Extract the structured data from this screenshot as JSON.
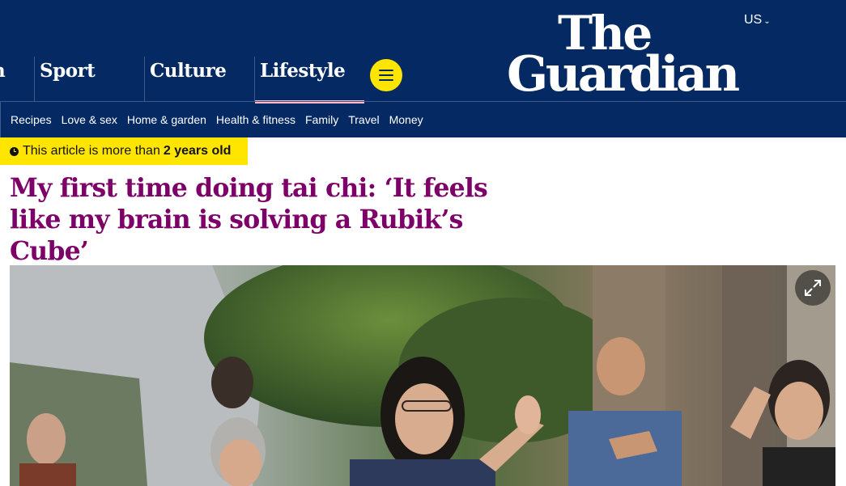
{
  "header": {
    "edition": "US",
    "logo": {
      "line1": "The",
      "line2": "Guardian"
    },
    "pillars": [
      {
        "label": "n"
      },
      {
        "label": "Sport"
      },
      {
        "label": "Culture"
      },
      {
        "label": "Lifestyle",
        "active": true
      }
    ],
    "menu_icon": "hamburger-icon",
    "subnav": [
      "Recipes",
      "Love & sex",
      "Home & garden",
      "Health & fitness",
      "Family",
      "Travel",
      "Money"
    ]
  },
  "article": {
    "age_warning": {
      "prefix": "This article is more than",
      "age": "2 years old",
      "icon": "clock-icon"
    },
    "headline": "My first time doing tai chi: ‘It feels like my brain is solving a Rubik’s Cube’",
    "hero_image": {
      "expand_icon": "expand-icon"
    }
  },
  "colors": {
    "brand_blue": "#052962",
    "headline_purple": "#7d0068",
    "highlight_yellow": "#ffe500",
    "active_pink": "#ffbac8"
  }
}
